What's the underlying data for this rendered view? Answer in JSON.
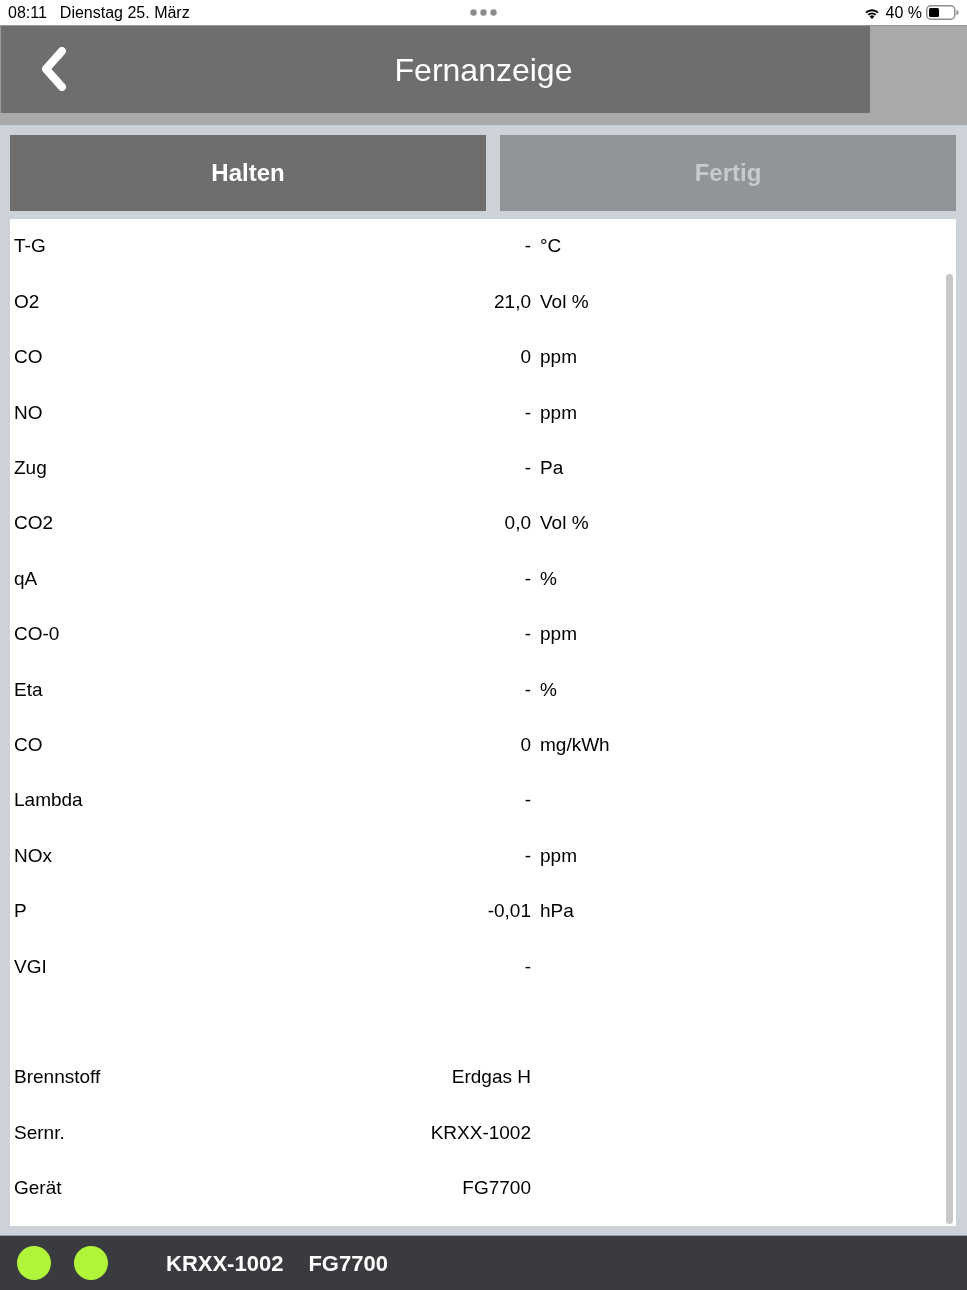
{
  "status_bar": {
    "time": "08:11",
    "date": "Dienstag 25. März",
    "battery": "40 %"
  },
  "header": {
    "title": "Fernanzeige"
  },
  "actions": [
    {
      "label": "Halten",
      "disabled": false
    },
    {
      "label": "Fertig",
      "disabled": true
    }
  ],
  "measurements": [
    {
      "name": "T-G",
      "value": "-",
      "unit": "°C"
    },
    {
      "name": "O2",
      "value": "21,0",
      "unit": "Vol %"
    },
    {
      "name": "CO",
      "value": "0",
      "unit": "ppm"
    },
    {
      "name": "NO",
      "value": "-",
      "unit": "ppm"
    },
    {
      "name": "Zug",
      "value": "-",
      "unit": "Pa"
    },
    {
      "name": "CO2",
      "value": "0,0",
      "unit": "Vol %"
    },
    {
      "name": "qA",
      "value": "-",
      "unit": "%"
    },
    {
      "name": "CO-0",
      "value": "-",
      "unit": "ppm"
    },
    {
      "name": "Eta",
      "value": "-",
      "unit": "%"
    },
    {
      "name": "CO",
      "value": "0",
      "unit": "mg/kWh"
    },
    {
      "name": "Lambda",
      "value": "-"
    },
    {
      "name": "NOx",
      "value": "-",
      "unit": "ppm"
    },
    {
      "name": "P",
      "value": "-0,01",
      "unit": "hPa"
    },
    {
      "name": "VGI",
      "value": "-"
    }
  ],
  "device_info": [
    {
      "name": "Brennstoff",
      "value": "Erdgas H"
    },
    {
      "name": "Sernr.",
      "value": "KRXX-1002"
    },
    {
      "name": "Gerät",
      "value": "FG7700"
    }
  ],
  "footer": {
    "indicators": [
      {
        "color": "#b0f53a"
      },
      {
        "color": "#b0f53a"
      }
    ],
    "serial": "KRXX-1002",
    "device": "FG7700"
  }
}
